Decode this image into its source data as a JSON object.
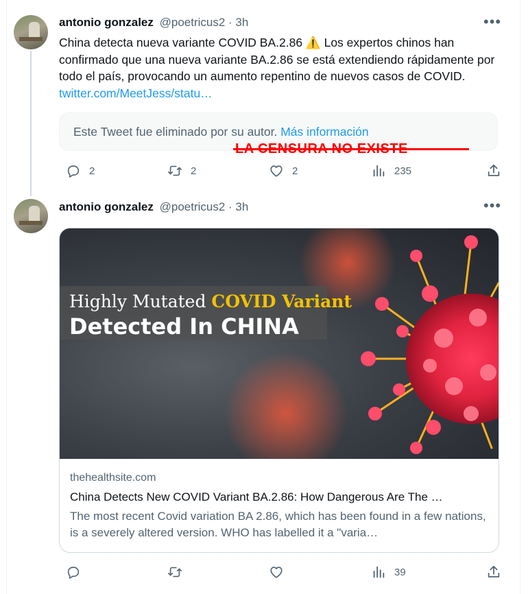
{
  "tweets": [
    {
      "author_name": "antonio gonzalez",
      "author_meta": "@poetricus2 · 3h",
      "text_main": "China detecta nueva variante COVID BA.2.86 ⚠️ Los expertos chinos han confirmado que una nueva variante BA.2.86 se está extendiendo rápidamente por todo el país, provocando un aumento repentino de nuevos casos de COVID. ",
      "text_link": "twitter.com/MeetJess/statu…",
      "quoted_notice": "Este Tweet fue eliminado por su autor. ",
      "quoted_link": "Más información",
      "overlay_text": "LA CENSURA NO EXISTE",
      "actions": {
        "reply_count": "2",
        "retweet_count": "2",
        "like_count": "2",
        "views_count": "235"
      }
    },
    {
      "author_name": "antonio gonzalez",
      "author_meta": "@poetricus2 · 3h",
      "card": {
        "image_line1_a": "Highly Mutated ",
        "image_line1_b": "COVID Variant",
        "image_line2": "Detected In CHINA",
        "domain": "thehealthsite.com",
        "title": "China Detects New COVID Variant BA.2.86: How Dangerous Are The …",
        "description": "The most recent Covid variation BA 2.86, which has been found in a few nations, is a severely altered version. WHO has labelled it a \"varia…"
      },
      "actions": {
        "reply_count": "",
        "retweet_count": "",
        "like_count": "",
        "views_count": "39"
      }
    }
  ],
  "more_icon": "•••",
  "colors": {
    "link": "#1d9bf0",
    "secondary": "#536471",
    "overlay_red": "#ff0000",
    "accent_yellow": "#f2c200"
  }
}
